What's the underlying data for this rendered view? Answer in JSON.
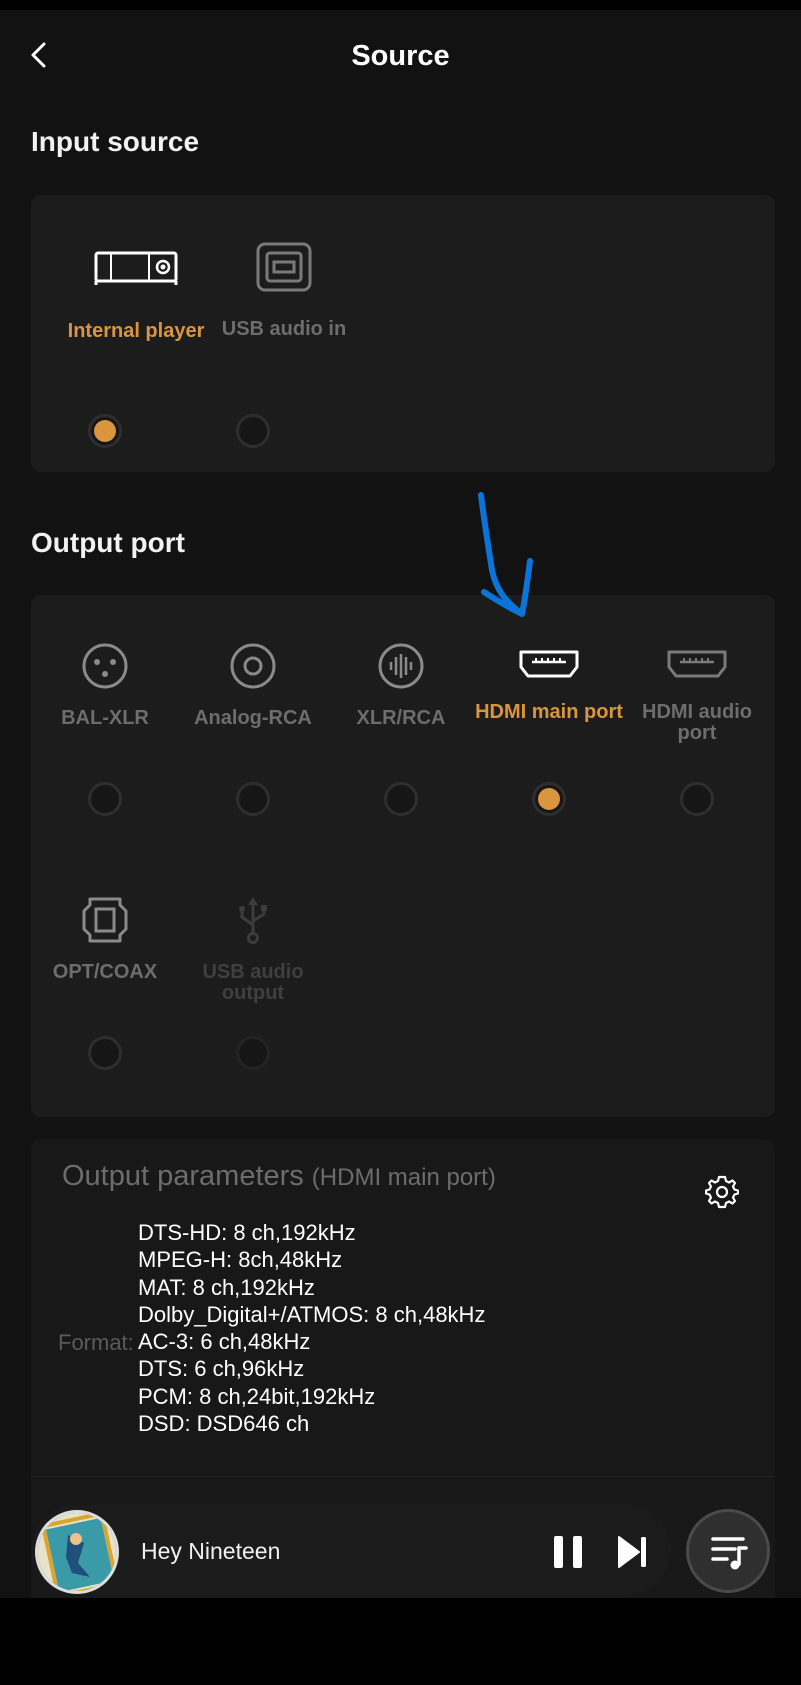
{
  "header": {
    "title": "Source",
    "back_icon": "chevron-left-icon"
  },
  "input_source": {
    "title": "Input source",
    "options": [
      {
        "label": "Internal player",
        "icon": "internal-player-icon",
        "selected": true
      },
      {
        "label": "USB audio in",
        "icon": "usb-b-port-icon",
        "selected": false
      }
    ]
  },
  "output_port": {
    "title": "Output port",
    "options": [
      {
        "label": "BAL-XLR",
        "icon": "xlr-connector-icon",
        "selected": false
      },
      {
        "label": "Analog-RCA",
        "icon": "rca-connector-icon",
        "selected": false
      },
      {
        "label": "XLR/RCA",
        "icon": "xlr-rca-waveform-icon",
        "selected": false
      },
      {
        "label": "HDMI main port",
        "icon": "hdmi-port-icon",
        "selected": true
      },
      {
        "label": "HDMI audio port",
        "icon": "hdmi-port-icon",
        "selected": false
      },
      {
        "label": "OPT/COAX",
        "icon": "optical-connector-icon",
        "selected": false
      },
      {
        "label": "USB audio output",
        "icon": "usb-icon",
        "selected": false,
        "disabled": true
      }
    ]
  },
  "output_parameters": {
    "title": "Output parameters",
    "subtitle": "(HDMI main port)",
    "settings_icon": "gear-icon",
    "format_label": "Format:",
    "formats": [
      "DTS-HD: 8 ch,192kHz",
      "MPEG-H: 8ch,48kHz",
      "MAT: 8 ch,192kHz",
      "Dolby_Digital+/ATMOS: 8 ch,48kHz",
      "AC-3: 6 ch,48kHz",
      "DTS: 6 ch,96kHz",
      "PCM: 8 ch,24bit,192kHz",
      "DSD: DSD646 ch"
    ]
  },
  "player": {
    "song": "Hey Nineteen",
    "pause_icon": "pause-icon",
    "next_icon": "skip-next-icon",
    "queue_icon": "playlist-icon"
  },
  "annotation": {
    "icon": "blue-hand-drawn-arrow-icon",
    "color": "#0a74d8"
  },
  "colors": {
    "accent": "#d9963f",
    "background": "#121212",
    "card": "#1c1c1c"
  }
}
